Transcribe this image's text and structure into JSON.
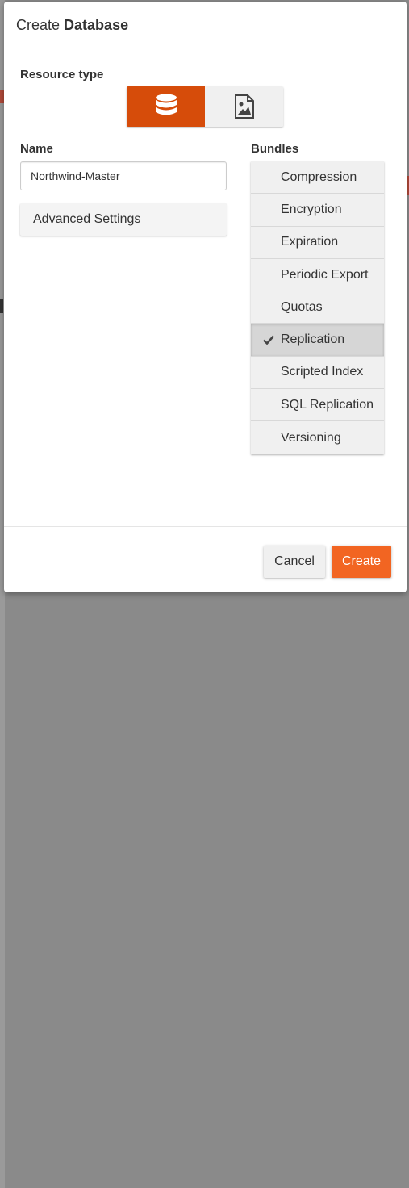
{
  "dialog": {
    "title_prefix": "Create",
    "title_bold": "Database"
  },
  "resource_type": {
    "label": "Resource type",
    "options": [
      {
        "icon": "database-icon",
        "selected": true
      },
      {
        "icon": "image-file-icon",
        "selected": false
      }
    ]
  },
  "name": {
    "label": "Name",
    "value": "Northwind-Master"
  },
  "advanced_settings": {
    "label": "Advanced Settings"
  },
  "bundles": {
    "label": "Bundles",
    "items": [
      {
        "label": "Compression",
        "checked": false
      },
      {
        "label": "Encryption",
        "checked": false
      },
      {
        "label": "Expiration",
        "checked": false
      },
      {
        "label": "Periodic Export",
        "checked": false
      },
      {
        "label": "Quotas",
        "checked": false
      },
      {
        "label": "Replication",
        "checked": true
      },
      {
        "label": "Scripted Index",
        "checked": false
      },
      {
        "label": "SQL Replication",
        "checked": false
      },
      {
        "label": "Versioning",
        "checked": false
      }
    ]
  },
  "footer": {
    "cancel_label": "Cancel",
    "create_label": "Create"
  },
  "colors": {
    "accent": "#f26522",
    "active_toggle": "#d64c0a"
  }
}
